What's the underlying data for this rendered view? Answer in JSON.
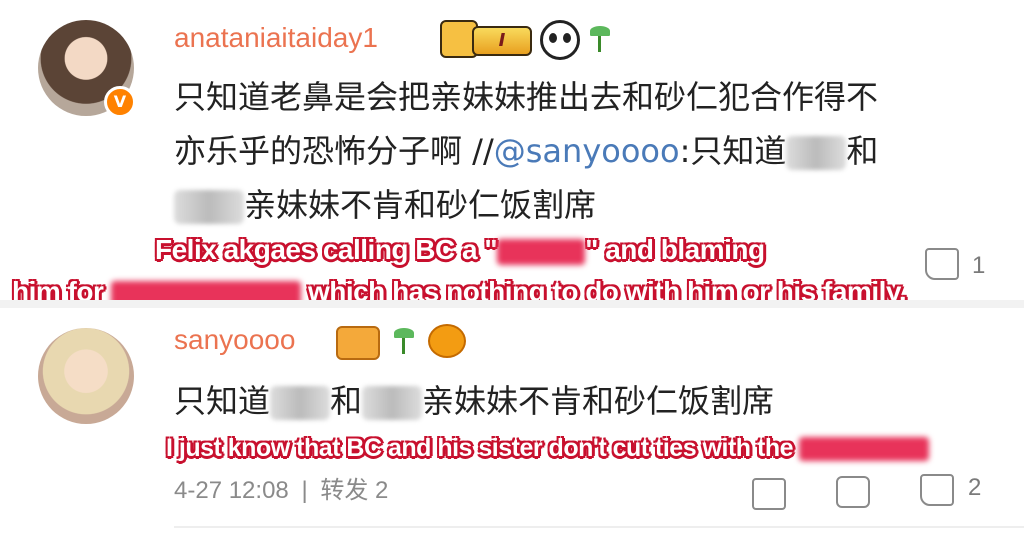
{
  "comments": [
    {
      "username": "anataniaitaiday1",
      "level_badge": "I",
      "text_line1": "只知道老鼻是会把亲妹妹推出去和砂仁犯合作得不",
      "text_line2_prefix": "亦乐乎的恐怖分子啊 //",
      "mention": "@sanyoooo",
      "text_line2_suffix": ":只知道",
      "text_line2_end": "和",
      "text_line3": "亲妹妹不肯和砂仁饭割席",
      "like_count": "1"
    },
    {
      "username": "sanyoooo",
      "text_prefix": "只知道",
      "text_mid": "和",
      "text_suffix": "亲妹妹不肯和砂仁饭割席",
      "timestamp": "4-27 12:08",
      "separator": "|",
      "repost_label": "转发 2",
      "like_count": "2"
    }
  ],
  "captions": {
    "cap1_line1_a": "Felix akgaes calling BC a \"",
    "cap1_line1_b": "\" and blaming",
    "cap1_line2_a": "him for",
    "cap1_line2_b": " which has nothing to do with him or his family.",
    "cap2": "I just know that BC and his sister don't cut ties with the"
  },
  "colors": {
    "username": "#eb7350",
    "mention": "#4a7ab8",
    "caption_outline": "#c8102e",
    "verified_badge": "#ff8200"
  },
  "icons": [
    "crown-badge-icon",
    "level-badge-icon",
    "panda-icon",
    "sprout-icon",
    "pufferfish-icon",
    "share-icon",
    "comment-icon",
    "like-icon"
  ]
}
